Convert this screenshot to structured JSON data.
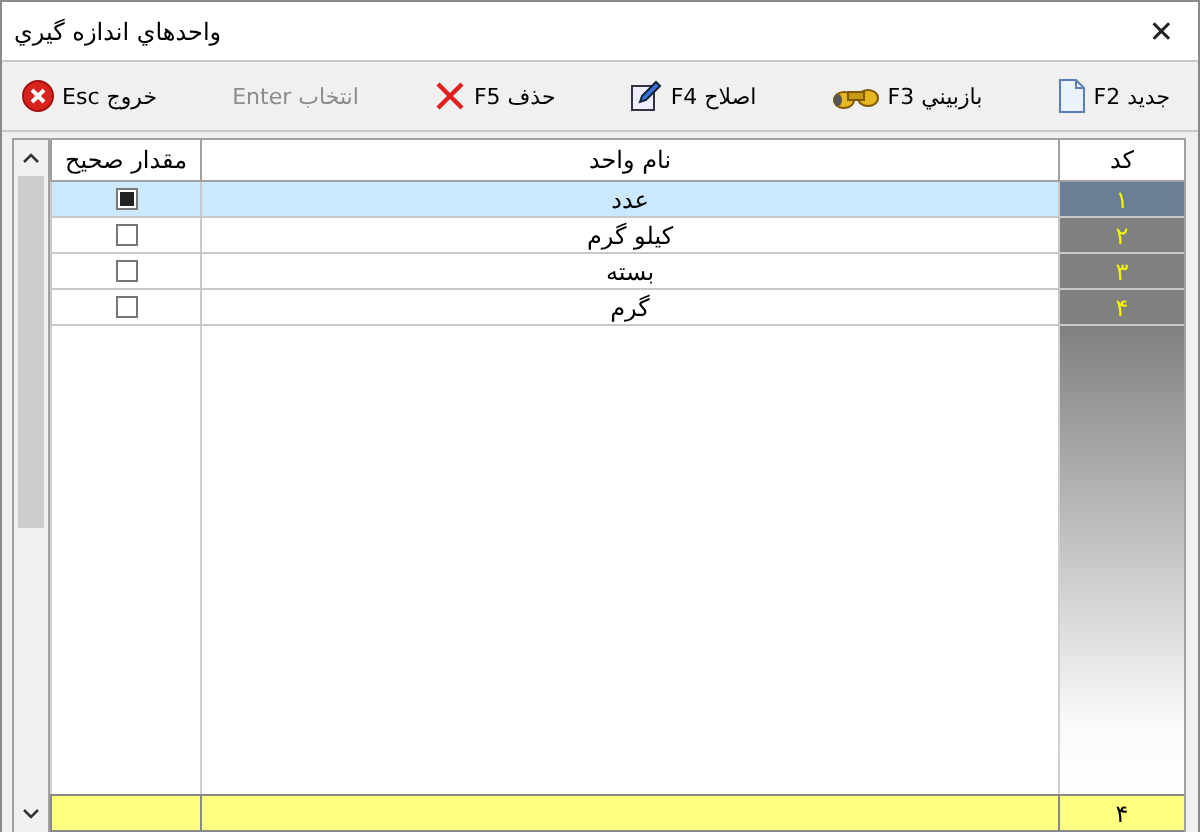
{
  "window": {
    "title": "واحدهاي اندازه گيري",
    "close": "✕"
  },
  "toolbar": [
    {
      "label": "جديد F2",
      "disabled": false
    },
    {
      "label": "بازبيني F3",
      "disabled": false
    },
    {
      "label": "اصلاح F4",
      "disabled": false
    },
    {
      "label": "حذف F5",
      "disabled": false
    },
    {
      "label": "انتخاب Enter",
      "disabled": true
    },
    {
      "label": "خروج Esc",
      "disabled": false
    }
  ],
  "table": {
    "columns": [
      "کد",
      "نام واحد",
      "مقدار صحيح"
    ],
    "rows": [
      {
        "code": "۱",
        "name": "عدد",
        "checked": true,
        "selected": true
      },
      {
        "code": "۲",
        "name": "کيلو گرم",
        "checked": false,
        "selected": false
      },
      {
        "code": "۳",
        "name": "بسته",
        "checked": false,
        "selected": false
      },
      {
        "code": "۴",
        "name": "گرم",
        "checked": false,
        "selected": false
      }
    ],
    "footer": {
      "count": "۴"
    }
  }
}
